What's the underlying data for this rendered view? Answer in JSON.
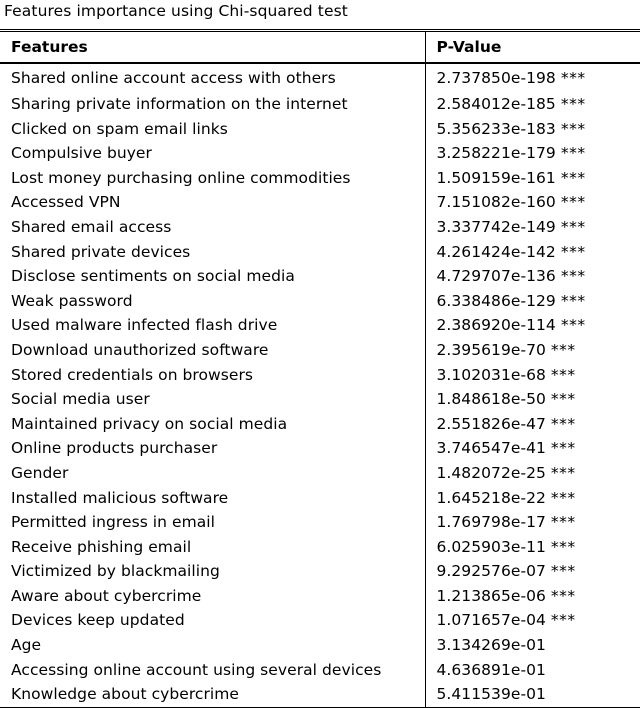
{
  "caption": "Features importance using Chi-squared test",
  "table": {
    "columns": [
      {
        "key": "feature",
        "label": "Features"
      },
      {
        "key": "pvalue",
        "label": "P-Value"
      }
    ],
    "rows": [
      {
        "feature": "Shared online account access with others",
        "pvalue": "2.737850e-198",
        "stars": "***"
      },
      {
        "feature": "Sharing private information on the internet",
        "pvalue": "2.584012e-185",
        "stars": "***"
      },
      {
        "feature": "Clicked on spam email links",
        "pvalue": "5.356233e-183",
        "stars": "***"
      },
      {
        "feature": "Compulsive buyer",
        "pvalue": "3.258221e-179",
        "stars": "***"
      },
      {
        "feature": "Lost money purchasing online commodities",
        "pvalue": "1.509159e-161",
        "stars": "***"
      },
      {
        "feature": "Accessed VPN",
        "pvalue": "7.151082e-160",
        "stars": "***"
      },
      {
        "feature": "Shared email access",
        "pvalue": "3.337742e-149",
        "stars": "***"
      },
      {
        "feature": "Shared private devices",
        "pvalue": "4.261424e-142",
        "stars": "***"
      },
      {
        "feature": "Disclose sentiments on social media",
        "pvalue": "4.729707e-136",
        "stars": "***"
      },
      {
        "feature": "Weak password",
        "pvalue": "6.338486e-129",
        "stars": "***"
      },
      {
        "feature": "Used malware infected flash drive",
        "pvalue": "2.386920e-114",
        "stars": "***"
      },
      {
        "feature": "Download unauthorized software",
        "pvalue": "2.395619e-70",
        "stars": "***"
      },
      {
        "feature": "Stored credentials on browsers",
        "pvalue": "3.102031e-68",
        "stars": "***"
      },
      {
        "feature": "Social media user",
        "pvalue": "1.848618e-50",
        "stars": "***"
      },
      {
        "feature": "Maintained privacy on social media",
        "pvalue": "2.551826e-47",
        "stars": "***"
      },
      {
        "feature": "Online products purchaser",
        "pvalue": "3.746547e-41",
        "stars": "***"
      },
      {
        "feature": "Gender",
        "pvalue": "1.482072e-25",
        "stars": "***"
      },
      {
        "feature": "Installed malicious software",
        "pvalue": "1.645218e-22",
        "stars": "***"
      },
      {
        "feature": "Permitted ingress in email",
        "pvalue": "1.769798e-17",
        "stars": "***"
      },
      {
        "feature": "Receive phishing email",
        "pvalue": "6.025903e-11",
        "stars": "***"
      },
      {
        "feature": "Victimized by blackmailing",
        "pvalue": "9.292576e-07",
        "stars": "***"
      },
      {
        "feature": "Aware about cybercrime",
        "pvalue": "1.213865e-06",
        "stars": "***"
      },
      {
        "feature": "Devices keep updated",
        "pvalue": "1.071657e-04",
        "stars": "***"
      },
      {
        "feature": "Age",
        "pvalue": "3.134269e-01",
        "stars": ""
      },
      {
        "feature": "Accessing online account using several devices",
        "pvalue": "4.636891e-01",
        "stars": ""
      },
      {
        "feature": "Knowledge about cybercrime",
        "pvalue": "5.411539e-01",
        "stars": ""
      }
    ]
  }
}
